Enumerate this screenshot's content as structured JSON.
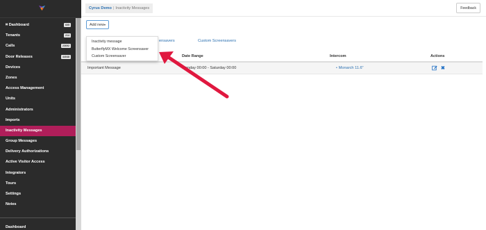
{
  "sidebar": {
    "logo_icon": "butterfly-logo-icon",
    "items": [
      {
        "label": "⌗ Dashboard",
        "badge": "605",
        "active": false
      },
      {
        "label": "Tenants",
        "badge": "214",
        "active": false
      },
      {
        "label": "Calls",
        "badge": "23692",
        "active": false
      },
      {
        "label": "Door Releases",
        "badge": "44048",
        "active": false
      },
      {
        "label": "Devices",
        "badge": "",
        "active": false
      },
      {
        "label": "Zones",
        "badge": "",
        "active": false
      },
      {
        "label": "Access Management",
        "badge": "",
        "active": false
      },
      {
        "label": "Units",
        "badge": "",
        "active": false
      },
      {
        "label": "Administrators",
        "badge": "",
        "active": false
      },
      {
        "label": "Imports",
        "badge": "",
        "active": false
      },
      {
        "label": "Inactivity Messages",
        "badge": "",
        "active": true
      },
      {
        "label": "Group Messages",
        "badge": "",
        "active": false
      },
      {
        "label": "Delivery Authorizations",
        "badge": "",
        "active": false
      },
      {
        "label": "Active Visitor Access",
        "badge": "",
        "active": false
      },
      {
        "label": "Integrators",
        "badge": "",
        "active": false
      },
      {
        "label": "Tours",
        "badge": "",
        "active": false
      },
      {
        "label": "Settings",
        "badge": "",
        "active": false
      },
      {
        "label": "Notes",
        "badge": "",
        "active": false
      }
    ],
    "bottom_label": "Dashboard"
  },
  "header": {
    "breadcrumb_link": "Cyrus Demo",
    "breadcrumb_separator": "|",
    "breadcrumb_current": "Inactivity Messages",
    "feedback_label": "Feedback"
  },
  "toolbar": {
    "add_new_label": "Add new",
    "add_new_caret": "▾"
  },
  "dropdown": {
    "items": [
      "Inactivity message",
      "ButterflyMX Welcome Screensaver",
      "Custom Screensaver"
    ]
  },
  "tabs": {
    "partial_label": "ensavers",
    "custom_label": "Custom Screensavers"
  },
  "table": {
    "headers": {
      "date_range": "Date Range",
      "intercom": "Intercom",
      "actions": "Actions"
    },
    "rows": [
      {
        "message": "Important Message",
        "date_range": "Monday 00:00 - Saturday 00:00",
        "intercom_bullet": "•",
        "intercom": "Monarch 11.6\"",
        "edit_icon": "edit-icon",
        "delete_icon": "delete-x-icon",
        "delete_glyph": "✖"
      }
    ]
  },
  "annotation": {
    "arrow_color": "#e0183f"
  },
  "colors": {
    "sidebar_bg": "#2b2b2b",
    "active_item": "#b01e5a",
    "link_blue": "#2a6fb0"
  }
}
